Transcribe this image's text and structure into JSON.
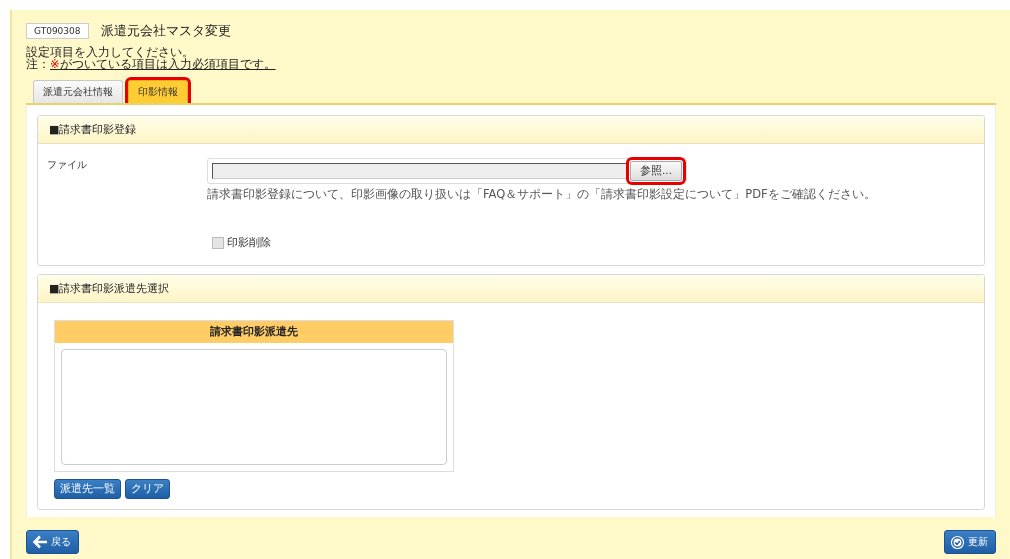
{
  "screen_code": "GT090308",
  "title": "派遣元会社マスタ変更",
  "instructions": "設定項目を入力してください。",
  "note": {
    "prefix": "注：",
    "mark": "※",
    "text": "がついている項目は入力必須項目です。"
  },
  "tabs": [
    {
      "label": "派遣元会社情報",
      "selected": false,
      "highlighted": false
    },
    {
      "label": "印影情報",
      "selected": true,
      "highlighted": true
    }
  ],
  "seal_registration": {
    "heading": "■請求書印影登録",
    "file_label": "ファイル",
    "browse_button": {
      "label": "参照...",
      "highlighted": true
    },
    "help_text": "請求書印影登録について、印影画像の取り扱いは「FAQ＆サポート」の「請求書印影設定について」PDFをご確認ください。",
    "delete_checkbox": {
      "label": "印影削除",
      "checked": false
    }
  },
  "destination_selection": {
    "heading": "■請求書印影派遣先選択",
    "list_header": "請求書印影派遣先",
    "buttons": [
      "派遣先一覧",
      "クリア"
    ]
  },
  "footer": {
    "back_button": "戻る",
    "update_button": "更新"
  }
}
